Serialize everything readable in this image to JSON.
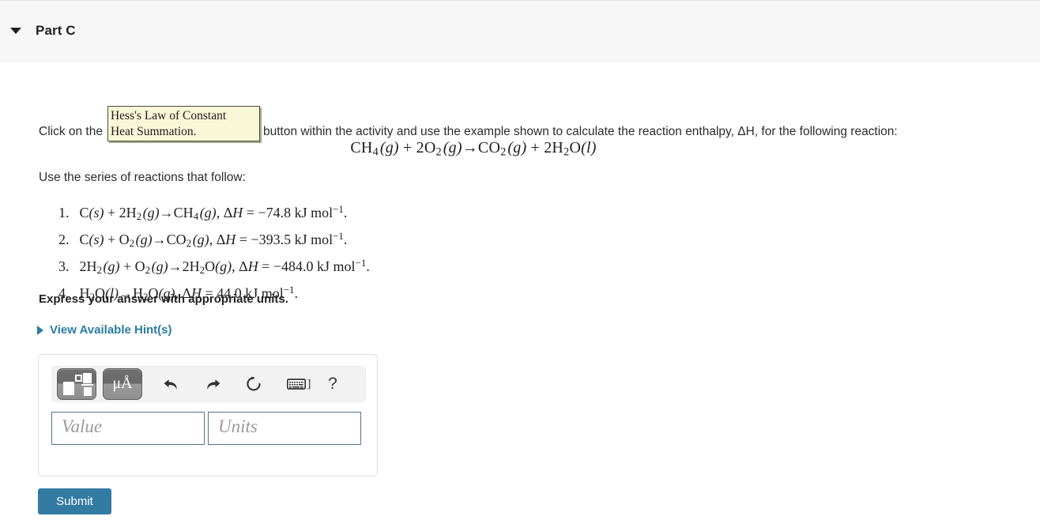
{
  "header": {
    "title": "Part C",
    "caret_icon": "caret-down-icon"
  },
  "prompt": {
    "before_button": "Click on the",
    "button_image_line1": "Hess's Law of Constant",
    "button_image_line2": "Heat Summation.",
    "after_button": "button within the activity and use the example shown to calculate the reaction enthalpy, ΔH, for the following reaction:"
  },
  "main_equation": {
    "text": "CH₄(g) + 2O₂(g)→CO₂(g) + 2H₂O(l)"
  },
  "series": {
    "intro": "Use the series of reactions that follow:",
    "reactions": [
      {
        "number": "1.",
        "equation": "C(s) + 2H₂(g)→CH₄(g),",
        "enthalpy": "ΔH = −74.8 kJ mol⁻¹."
      },
      {
        "number": "2.",
        "equation": "C(s) + O₂(g)→CO₂(g),",
        "enthalpy": "ΔH = −393.5 kJ mol⁻¹."
      },
      {
        "number": "3.",
        "equation": "2H₂(g) + O₂(g)→2H₂O(g),",
        "enthalpy": "ΔH = −484.0 kJ mol⁻¹."
      },
      {
        "number": "4.",
        "equation": "H₂O(l)→H₂O(g),",
        "enthalpy": "ΔH = 44.0 kJ mol⁻¹."
      }
    ]
  },
  "instructions": {
    "express": "Express your answer with appropriate units."
  },
  "hints": {
    "label": "View Available Hint(s)",
    "caret_icon": "caret-right-icon",
    "color": "#2a7ba5"
  },
  "answer_area": {
    "toolbar": {
      "template_button": "template-icon",
      "units_button_label": "μÅ",
      "undo_icon": "undo-arrow-icon",
      "redo_icon": "redo-arrow-icon",
      "reset_icon": "reset-circular-arrow-icon",
      "keyboard_icon": "keyboard-icon",
      "keyboard_bracket": "]",
      "help_label": "?"
    },
    "value_placeholder": "Value",
    "units_placeholder": "Units"
  },
  "submit": {
    "label": "Submit",
    "color": "#337ba3"
  }
}
